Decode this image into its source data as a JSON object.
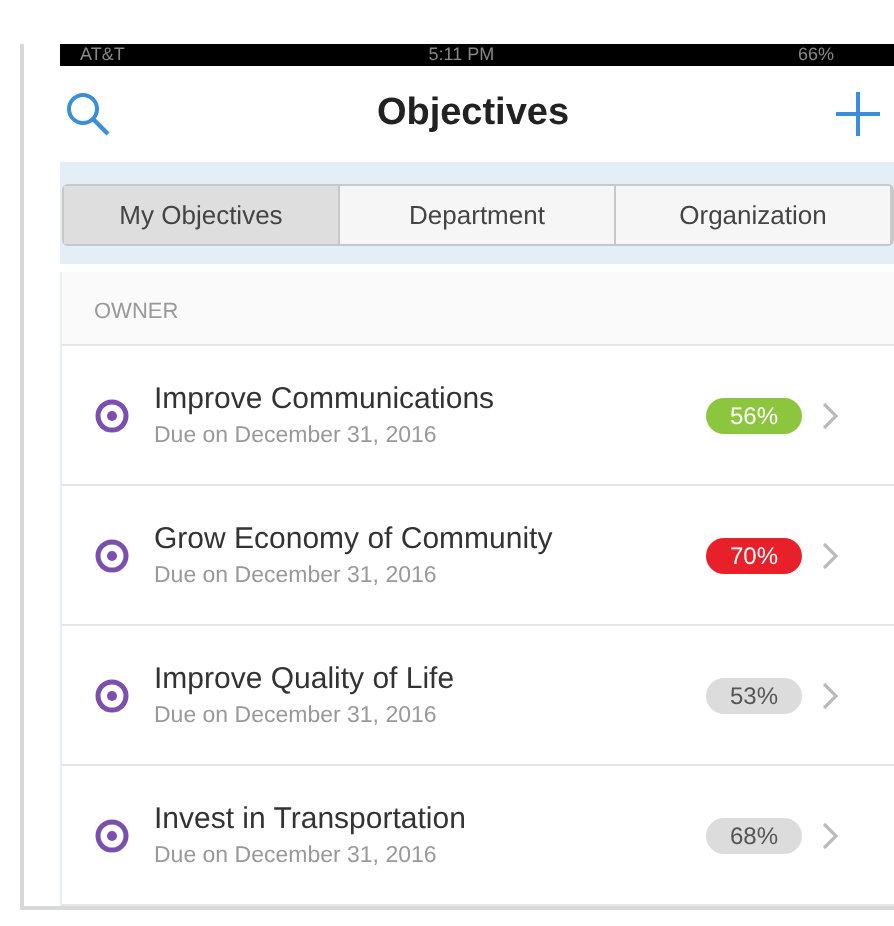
{
  "status_bar": {
    "carrier": "AT&T",
    "time": "5:11 PM",
    "battery": "66%"
  },
  "nav": {
    "title": "Objectives"
  },
  "tabs": [
    {
      "label": "My Objectives",
      "selected": true
    },
    {
      "label": "Department",
      "selected": false
    },
    {
      "label": "Organization",
      "selected": false
    }
  ],
  "section": {
    "header": "OWNER"
  },
  "objectives": [
    {
      "name": "Improve Communications",
      "due": "Due on December 31, 2016",
      "progress": "56%",
      "color": "#8cc63f"
    },
    {
      "name": "Grow Economy of Community",
      "due": "Due on December 31, 2016",
      "progress": "70%",
      "color": "#e8202a"
    },
    {
      "name": "Improve Quality of Life",
      "due": "Due on December 31, 2016",
      "progress": "53%",
      "color": "#dcdcdc"
    },
    {
      "name": "Invest in Transportation",
      "due": "Due on December 31, 2016",
      "progress": "68%",
      "color": "#dcdcdc"
    }
  ]
}
